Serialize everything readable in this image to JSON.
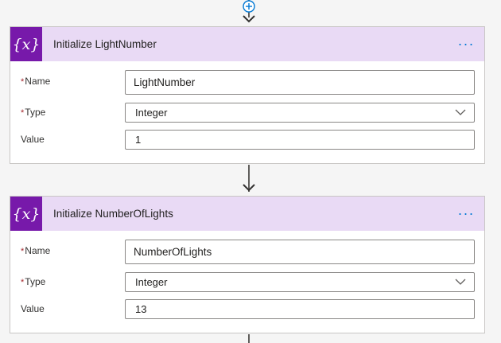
{
  "steps": [
    {
      "title": "Initialize LightNumber",
      "icon_text": "{x}",
      "icon": "variable-icon",
      "fields": {
        "name": {
          "label": "Name",
          "required": true,
          "value": "LightNumber"
        },
        "type": {
          "label": "Type",
          "required": true,
          "value": "Integer"
        },
        "value": {
          "label": "Value",
          "required": false,
          "value": "1"
        }
      }
    },
    {
      "title": "Initialize NumberOfLights",
      "icon_text": "{x}",
      "icon": "variable-icon",
      "fields": {
        "name": {
          "label": "Name",
          "required": true,
          "value": "NumberOfLights"
        },
        "type": {
          "label": "Type",
          "required": true,
          "value": "Integer"
        },
        "value": {
          "label": "Value",
          "required": false,
          "value": "13"
        }
      }
    }
  ],
  "more_menu_glyph": "···",
  "required_marker": "*",
  "colors": {
    "header_bg": "#e9daf5",
    "icon_bg": "#7719aa",
    "accent": "#0078d4",
    "required": "#a4262c"
  }
}
